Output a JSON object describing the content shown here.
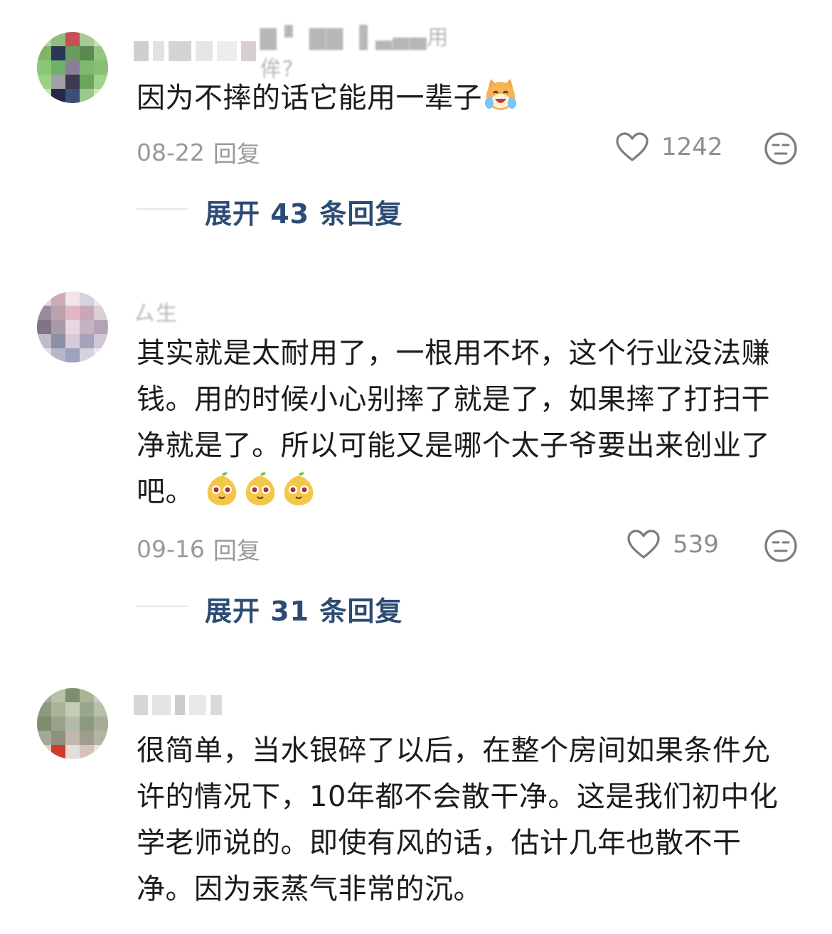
{
  "comments": [
    {
      "username": "▇ ▘ ▇▇ ▐ ▃▄▄用侔?",
      "content_text": "因为不摔的话它能用一辈子",
      "date": "08-22",
      "reply_label": "回复",
      "likes": "1242",
      "expand_label": "展开 43 条回复",
      "emoji": "laughing-cat-emoji"
    },
    {
      "username": "ㄙ生",
      "content_text": "其实就是太耐用了，一根用不坏，这个行业没法赚钱。用的时候小心别摔了就是了，如果摔了打扫干净就是了。所以可能又是哪个太子爷要出来创业了吧。",
      "date": "09-16",
      "reply_label": "回复",
      "likes": "539",
      "expand_label": "展开 31 条回复",
      "emoji": "pear-face-emoji"
    },
    {
      "username": "",
      "content_text": "很简单，当水银碎了以后，在整个房间如果条件允许的情况下，10年都不会散干净。这是我们初中化学老师说的。即使有风的话，估计几年也散不干净。因为汞蒸气非常的沉。"
    }
  ],
  "colors": {
    "expand": "#2c4b74",
    "meta": "#9a9a9a",
    "text": "#1b1b1b"
  }
}
